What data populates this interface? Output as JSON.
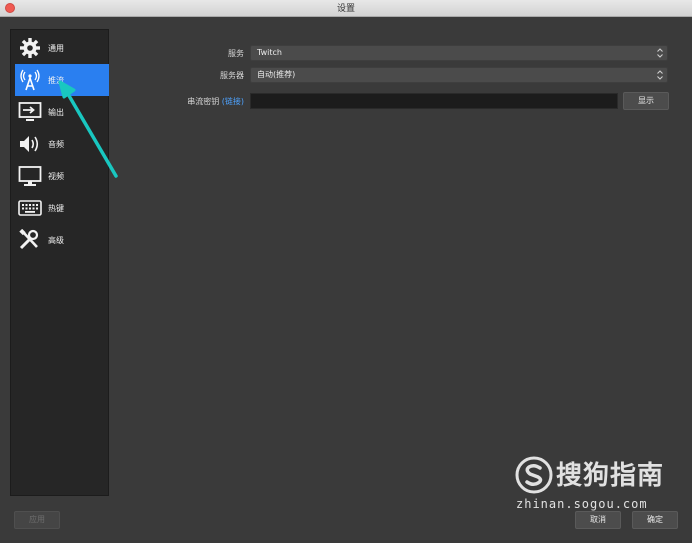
{
  "window": {
    "title": "设置"
  },
  "sidebar": {
    "items": [
      {
        "label": "通用",
        "icon": "gear-icon",
        "active": false
      },
      {
        "label": "推流",
        "icon": "antenna-icon",
        "active": true
      },
      {
        "label": "输出",
        "icon": "output-icon",
        "active": false
      },
      {
        "label": "音频",
        "icon": "speaker-icon",
        "active": false
      },
      {
        "label": "视频",
        "icon": "monitor-icon",
        "active": false
      },
      {
        "label": "热键",
        "icon": "keyboard-icon",
        "active": false
      },
      {
        "label": "高级",
        "icon": "tools-icon",
        "active": false
      }
    ]
  },
  "stream": {
    "service_label": "服务",
    "service_value": "Twitch",
    "server_label": "服务器",
    "server_value": "自动(推荐)",
    "key_label": "串流密钥",
    "key_link": "(链接)",
    "key_value": "",
    "show_button": "显示"
  },
  "footer": {
    "apply_button": "应用",
    "cancel_button": "取消",
    "ok_button": "确定"
  },
  "watermark": {
    "brand": "搜狗指南",
    "url": "zhinan.sogou.com"
  },
  "colors": {
    "accent": "#2a7ff0",
    "background": "#3a3a3a",
    "sidebar": "#262626",
    "annotation_arrow": "#19c7c0"
  }
}
